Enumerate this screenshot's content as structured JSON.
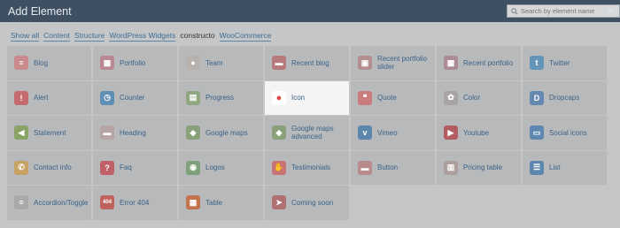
{
  "dialog": {
    "title": "Add Element",
    "close_label": "×"
  },
  "search": {
    "placeholder": "Search by element name"
  },
  "filters": [
    {
      "label": "Show all",
      "plain": false
    },
    {
      "label": "Content",
      "plain": false
    },
    {
      "label": "Structure",
      "plain": false
    },
    {
      "label": "WordPress Widgets",
      "plain": false
    },
    {
      "label": "constructo",
      "plain": true
    },
    {
      "label": "WooCommerce",
      "plain": false
    }
  ],
  "elements": [
    {
      "label": "Blog",
      "icon": "blog-icon",
      "color": "#c98a8c",
      "glyph": "≡"
    },
    {
      "label": "Portfolio",
      "icon": "portfolio-icon",
      "color": "#b98892",
      "glyph": "▦"
    },
    {
      "label": "Team",
      "icon": "team-icon",
      "color": "#b7b2ae",
      "glyph": "●"
    },
    {
      "label": "Recent blog",
      "icon": "recent-blog-icon",
      "color": "#b77a7c",
      "glyph": "▬"
    },
    {
      "label": "Recent portfolio slider",
      "icon": "recent-portfolio-slider-icon",
      "color": "#b48e8e",
      "glyph": "▣"
    },
    {
      "label": "Recent portfolio",
      "icon": "recent-portfolio-icon",
      "color": "#ac8b95",
      "glyph": "▦"
    },
    {
      "label": "Twitter",
      "icon": "twitter-icon",
      "color": "#6494b8",
      "glyph": "t"
    },
    {
      "label": "Alert",
      "icon": "alert-icon",
      "color": "#c56b6e",
      "glyph": "!"
    },
    {
      "label": "Counter",
      "icon": "counter-icon",
      "color": "#5f8fb3",
      "glyph": "◷"
    },
    {
      "label": "Progress",
      "icon": "progress-icon",
      "color": "#90a680",
      "glyph": "▤"
    },
    {
      "label": "Icon",
      "icon": "icon-element-icon",
      "color": "#e8473f",
      "glyph": "●",
      "active": true
    },
    {
      "label": "Quote",
      "icon": "quote-icon",
      "color": "#c97b7d",
      "glyph": "❝"
    },
    {
      "label": "Color",
      "icon": "color-icon",
      "color": "#a8a4a6",
      "glyph": "✿"
    },
    {
      "label": "Dropcaps",
      "icon": "dropcaps-icon",
      "color": "#6689b1",
      "glyph": "D"
    },
    {
      "label": "Statement",
      "icon": "statement-icon",
      "color": "#89a266",
      "glyph": "◀"
    },
    {
      "label": "Heading",
      "icon": "heading-icon",
      "color": "#b7a5a5",
      "glyph": "▬"
    },
    {
      "label": "Google maps",
      "icon": "google-maps-icon",
      "color": "#8aa07b",
      "glyph": "◆"
    },
    {
      "label": "Google maps advanced",
      "icon": "google-maps-advanced-icon",
      "color": "#8aa07b",
      "glyph": "◆"
    },
    {
      "label": "Vimeo",
      "icon": "vimeo-icon",
      "color": "#5d86ad",
      "glyph": "v"
    },
    {
      "label": "Youtube",
      "icon": "youtube-icon",
      "color": "#b35d63",
      "glyph": "▶"
    },
    {
      "label": "Social icons",
      "icon": "social-icons-icon",
      "color": "#5f88b0",
      "glyph": "▭"
    },
    {
      "label": "Contact info",
      "icon": "contact-info-icon",
      "color": "#c6a264",
      "glyph": "✆"
    },
    {
      "label": "Faq",
      "icon": "faq-icon",
      "color": "#c06068",
      "glyph": "?"
    },
    {
      "label": "Logos",
      "icon": "logos-icon",
      "color": "#7ea07a",
      "glyph": "◉"
    },
    {
      "label": "Testimonials",
      "icon": "testimonials-icon",
      "color": "#c87376",
      "glyph": "✋"
    },
    {
      "label": "Button",
      "icon": "button-icon",
      "color": "#b98a8c",
      "glyph": "▬"
    },
    {
      "label": "Pricing table",
      "icon": "pricing-table-icon",
      "color": "#ae9f9f",
      "glyph": "▥"
    },
    {
      "label": "List",
      "icon": "list-icon",
      "color": "#5d87ae",
      "glyph": "☰"
    },
    {
      "label": "Accordion/Toggle",
      "icon": "accordion-toggle-icon",
      "color": "#a9a9a9",
      "glyph": "≡"
    },
    {
      "label": "Error 404",
      "icon": "error-404-icon",
      "color": "#c0625d",
      "glyph": "404"
    },
    {
      "label": "Table",
      "icon": "table-icon",
      "color": "#c4734f",
      "glyph": "▦"
    },
    {
      "label": "Coming soon",
      "icon": "coming-soon-icon",
      "color": "#b06f71",
      "glyph": "➤"
    }
  ]
}
